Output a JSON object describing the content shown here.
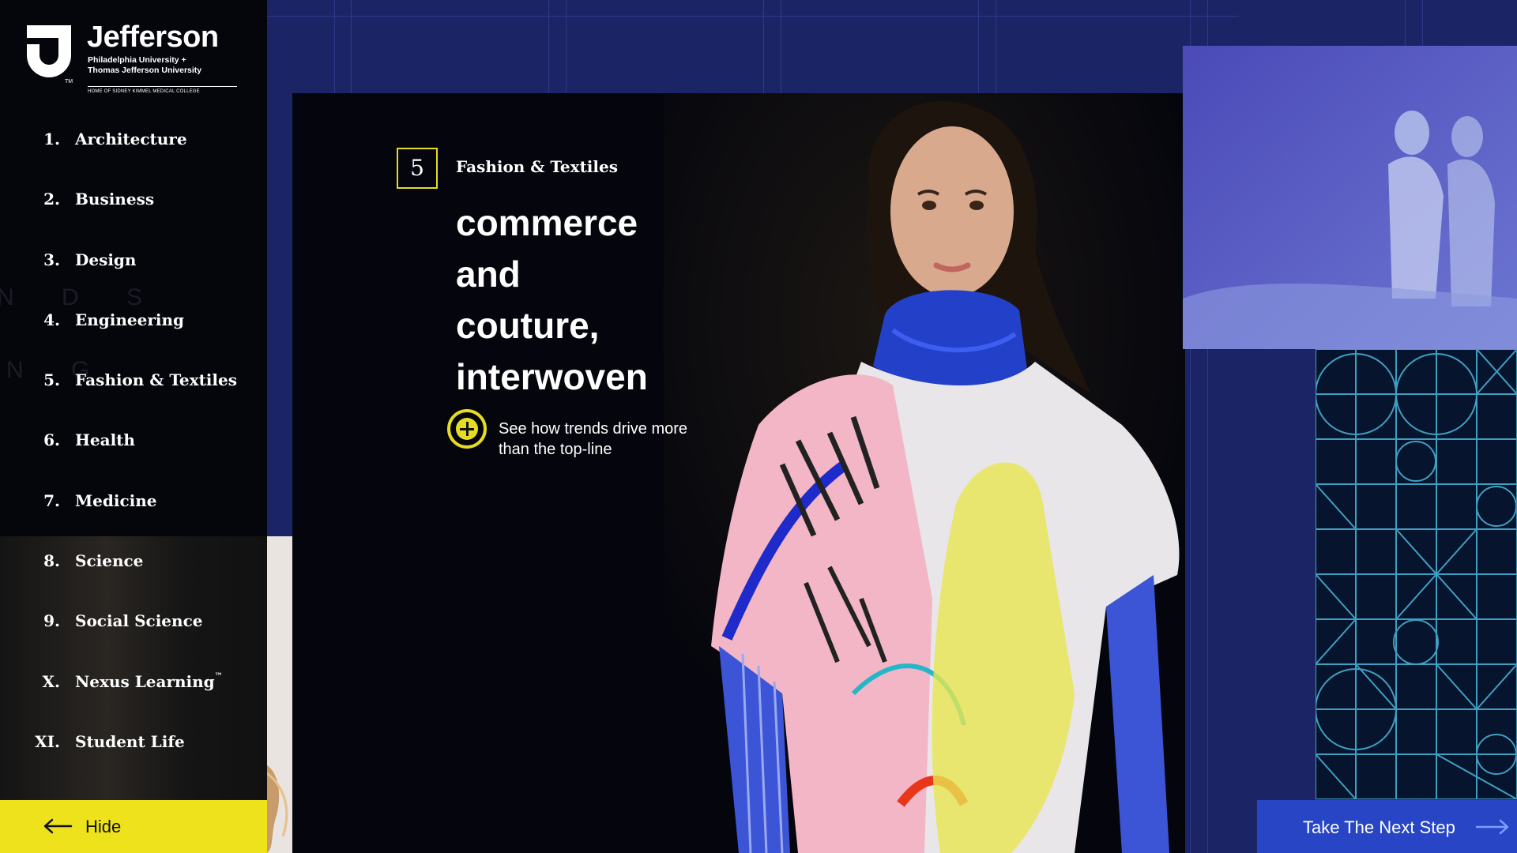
{
  "brand": {
    "name": "Jefferson",
    "subtitle": "Philadelphia University +\nThomas Jefferson University",
    "tagline": "HOME OF SIDNEY KIMMEL MEDICAL COLLEGE",
    "trademark": "TM"
  },
  "sidebar": {
    "items": [
      {
        "num": "1.",
        "label": "Architecture"
      },
      {
        "num": "2.",
        "label": "Business"
      },
      {
        "num": "3.",
        "label": "Design"
      },
      {
        "num": "4.",
        "label": "Engineering"
      },
      {
        "num": "5.",
        "label": "Fashion & Textiles"
      },
      {
        "num": "6.",
        "label": "Health"
      },
      {
        "num": "7.",
        "label": "Medicine"
      },
      {
        "num": "8.",
        "label": "Science"
      },
      {
        "num": "9.",
        "label": "Social Science"
      },
      {
        "num": "X.",
        "label": "Nexus Learning",
        "sup": "™"
      },
      {
        "num": "XI.",
        "label": "Student Life"
      }
    ],
    "ghost_1": "N D S",
    "ghost_2": "N G",
    "hide_label": "Hide"
  },
  "feature": {
    "number": "5",
    "category": "Fashion & Textiles",
    "headline": [
      "commerce",
      "and",
      "couture,",
      "interwoven"
    ],
    "cta_text": "See how trends drive more than the top-line"
  },
  "footer": {
    "next_step_label": "Take The Next Step"
  },
  "colors": {
    "background": "#1b2566",
    "sidebar": "#05060c",
    "accent_yellow": "#ede21b",
    "button_blue": "#2845c6"
  },
  "icons": {
    "hide": "arrow-left-icon",
    "next": "arrow-right-icon",
    "expand": "plus-circle-icon",
    "logo": "jefferson-j-logo"
  }
}
